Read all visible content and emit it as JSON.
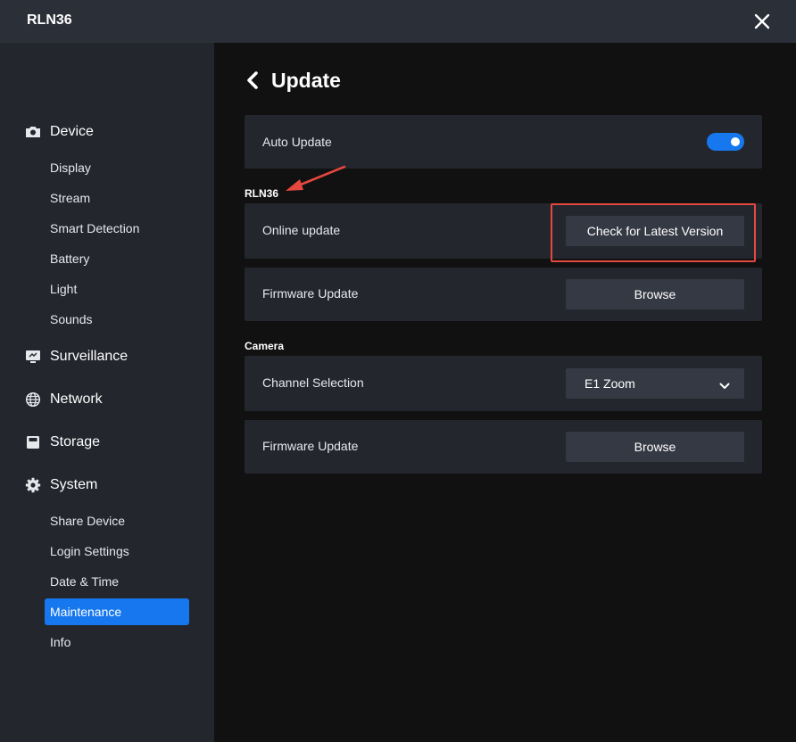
{
  "window": {
    "title": "RLN36"
  },
  "sidebar": {
    "sections": [
      {
        "label": "Device",
        "icon": "camera-icon"
      },
      {
        "label": "Surveillance",
        "icon": "monitor-icon"
      },
      {
        "label": "Network",
        "icon": "globe-icon"
      },
      {
        "label": "Storage",
        "icon": "storage-icon"
      },
      {
        "label": "System",
        "icon": "gear-icon"
      }
    ],
    "device_items": [
      "Display",
      "Stream",
      "Smart Detection",
      "Battery",
      "Light",
      "Sounds"
    ],
    "system_items": [
      "Share Device",
      "Login Settings",
      "Date & Time",
      "Maintenance",
      "Info"
    ],
    "active_item": "Maintenance"
  },
  "main": {
    "title": "Update",
    "auto_update": {
      "label": "Auto Update",
      "enabled": true
    },
    "rln36": {
      "section_label": "RLN36",
      "online_update": {
        "label": "Online update",
        "button": "Check for Latest Version"
      },
      "firmware_update": {
        "label": "Firmware Update",
        "button": "Browse"
      }
    },
    "camera": {
      "section_label": "Camera",
      "channel_selection": {
        "label": "Channel Selection",
        "selected": "E1 Zoom"
      },
      "firmware_update": {
        "label": "Firmware Update",
        "button": "Browse"
      }
    }
  },
  "colors": {
    "accent": "#1677ee",
    "annotation": "#e5483f",
    "panel": "#23262d",
    "sidebar": "#23262d",
    "background": "#111111"
  }
}
